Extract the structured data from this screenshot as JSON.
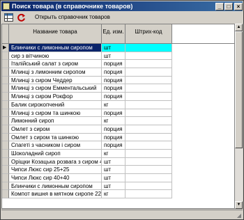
{
  "window": {
    "title": "Поиск товара (в справочнике товаров)",
    "min_glyph": "_",
    "max_glyph": "□",
    "close_glyph": "×"
  },
  "toolbar": {
    "open_catalog_label": "Открыть справочник товаров",
    "grid_icon": "grid-icon",
    "refresh_icon": "refresh-icon"
  },
  "table": {
    "columns": [
      "Название товара",
      "Ед. изм.",
      "Штрих-код"
    ],
    "selected_row": 0,
    "selected_marker": "▶",
    "rows": [
      {
        "name": "Блинчики с лимонным сиропом",
        "unit": "шт",
        "code": ""
      },
      {
        "name": "сир з вітчиною",
        "unit": "шт",
        "code": ""
      },
      {
        "name": "Італійський салат з сиром",
        "unit": "порция",
        "code": ""
      },
      {
        "name": "Млинці з лимонним сиропом",
        "unit": "порция",
        "code": ""
      },
      {
        "name": "Млинці з сиром Чеддер",
        "unit": "порция",
        "code": ""
      },
      {
        "name": "Млинці з сиром Емментальський",
        "unit": "порция",
        "code": ""
      },
      {
        "name": "Млинці з сиром Рокфор",
        "unit": "порция",
        "code": ""
      },
      {
        "name": "Балик сирокопчений",
        "unit": "кг",
        "code": ""
      },
      {
        "name": "Млинці з сиром та шинкою",
        "unit": "порция",
        "code": ""
      },
      {
        "name": "Лимонний сироп",
        "unit": "кг",
        "code": ""
      },
      {
        "name": "Омлет з сиром",
        "unit": "порция",
        "code": ""
      },
      {
        "name": "Омлет з сиром та шинкою",
        "unit": "порция",
        "code": ""
      },
      {
        "name": "Спагеті з часником і сиром",
        "unit": "порция",
        "code": ""
      },
      {
        "name": "Шоколадний сироп",
        "unit": "кг",
        "code": ""
      },
      {
        "name": "Оріщки Козацька розвага з сиром 40",
        "unit": "шт",
        "code": ""
      },
      {
        "name": "Чипси Люкс сир 25+25",
        "unit": "шт",
        "code": ""
      },
      {
        "name": "Чипси Люкс сир 40+40",
        "unit": "шт",
        "code": ""
      },
      {
        "name": "Блинчики с лимонным сиропом",
        "unit": "шт",
        "code": ""
      },
      {
        "name": "Компот вишня в мятном сиропе 22",
        "unit": "кг",
        "code": ""
      }
    ]
  },
  "scrollbar": {
    "up_glyph": "▲",
    "down_glyph": "▼"
  },
  "colors": {
    "title_bar": "#0a246a",
    "selected_row": "#0a246a",
    "selected_cells": "#00ffff"
  }
}
